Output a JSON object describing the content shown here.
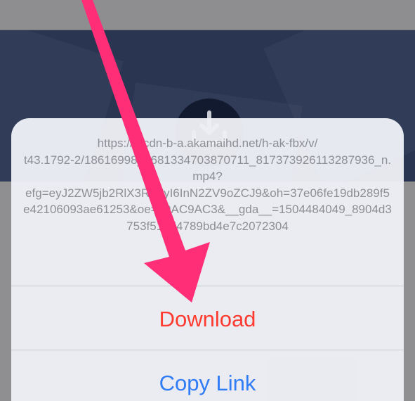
{
  "sheet": {
    "message": "https://fbcdn-b-a.akamaihd.net/h-ak-fbx/v/\nt43.1792-2/18616998_1681334703870711_817373926113287936_n.mp4?\nefg=eyJ2ZW5jb2RlX3RhZyI6InN2ZV9oZCJ9&oh=37e06fe19db289f5e42106093ae61253&oe=59AC9AC3&__gda__=1504484049_8904d3753f51354789bd4e7c2072304",
    "actions": {
      "download_label": "Download",
      "copy_link_label": "Copy Link"
    }
  },
  "icons": {
    "banner": "download-icon",
    "overlay": "arrow-pointer-icon"
  },
  "colors": {
    "banner": "#2a3552",
    "download_action": "#ff3b30",
    "copy_action": "#2f7cf6",
    "arrow": "#ff2e76"
  }
}
